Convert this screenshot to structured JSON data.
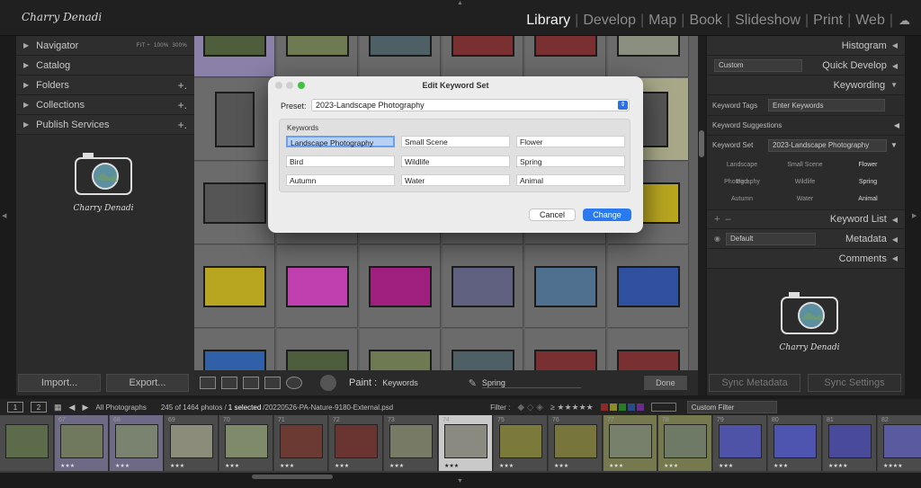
{
  "top": {
    "logo_text": "Charry Denadi",
    "modules": [
      "Library",
      "Develop",
      "Map",
      "Book",
      "Slideshow",
      "Print",
      "Web"
    ],
    "active_module": "Library"
  },
  "left_panel": {
    "navigator": {
      "label": "Navigator",
      "zoom": [
        "FIT ÷",
        "100%",
        "300%"
      ]
    },
    "items": [
      {
        "label": "Catalog",
        "plus": ""
      },
      {
        "label": "Folders",
        "plus": "+."
      },
      {
        "label": "Collections",
        "plus": "+."
      },
      {
        "label": "Publish Services",
        "plus": "+."
      }
    ],
    "import_label": "Import...",
    "export_label": "Export..."
  },
  "toolbar": {
    "paint_label": "Paint :",
    "paint_value": "Keywords",
    "spring_label": "Spring",
    "done_label": "Done"
  },
  "right_panel": {
    "histogram": "Histogram",
    "quick_develop": "Quick Develop",
    "quick_develop_value": "Custom",
    "keywording": "Keywording",
    "keyword_tags_label": "Keyword Tags",
    "keyword_tags_value": "Enter Keywords",
    "keyword_suggestions": "Keyword Suggestions",
    "keyword_set_label": "Keyword Set",
    "keyword_set_value": "2023-Landscape Photography",
    "keyword_grid": [
      "Landscape Photography",
      "Small Scene",
      "Flower",
      "Bird",
      "Wildlife",
      "Spring",
      "Autumn",
      "Water",
      "Animal"
    ],
    "keyword_list": "Keyword List",
    "metadata": "Metadata",
    "metadata_value": "Default",
    "comments": "Comments",
    "sync_metadata": "Sync Metadata",
    "sync_settings": "Sync Settings"
  },
  "filmstrip": {
    "page1": "1",
    "page2": "2",
    "source": "All Photographs",
    "count": "245 of 1464 photos /",
    "selected": "1 selected",
    "filename": "/20220526-PA-Nature-9180-External.psd",
    "filter_label": "Filter :",
    "filter_value": "Custom Filter",
    "cells": [
      {
        "num": "",
        "stars": "",
        "color": "#5c6b4a"
      },
      {
        "num": "67",
        "stars": "★★★",
        "color": "#70785e"
      },
      {
        "num": "68",
        "stars": "★★★",
        "color": "#7a8270"
      },
      {
        "num": "69",
        "stars": "★★★",
        "color": "#8b8d7a"
      },
      {
        "num": "70",
        "stars": "★★★",
        "color": "#7e8a6a"
      },
      {
        "num": "71",
        "stars": "★★★",
        "color": "#6b3a32"
      },
      {
        "num": "72",
        "stars": "★★★",
        "color": "#6a3430"
      },
      {
        "num": "73",
        "stars": "★★★",
        "color": "#777a64"
      },
      {
        "num": "74",
        "stars": "★★★",
        "color": "#8a8a80"
      },
      {
        "num": "75",
        "stars": "★★★",
        "color": "#7c7a3a"
      },
      {
        "num": "76",
        "stars": "★★★",
        "color": "#77743c"
      },
      {
        "num": "77",
        "stars": "★★★",
        "color": "#76806a"
      },
      {
        "num": "78",
        "stars": "★★★",
        "color": "#6e7a66"
      },
      {
        "num": "79",
        "stars": "★★★",
        "color": "#4e53a8"
      },
      {
        "num": "80",
        "stars": "★★★",
        "color": "#4e55b0"
      },
      {
        "num": "81",
        "stars": "★★★★",
        "color": "#4a4a9a"
      },
      {
        "num": "82",
        "stars": "★★★★",
        "color": "#5a5aa0"
      }
    ]
  },
  "dialog": {
    "title": "Edit Keyword Set",
    "preset_label": "Preset:",
    "preset_value": "2023-Landscape Photography",
    "keywords_label": "Keywords",
    "keywords": [
      "Landscape Photography",
      "Small Scene",
      "Flower",
      "Bird",
      "Wildlife",
      "Spring",
      "Autumn",
      "Water",
      "Animal"
    ],
    "cancel": "Cancel",
    "change": "Change"
  },
  "grid_colors": [
    "#4e5e3c",
    "#6d7a52",
    "#4f5f66",
    "#7a3030",
    "#7a3030",
    "#8a8f80",
    "#555",
    "#777",
    "#6a6a66",
    "#7a8470",
    "#3a3a9a",
    "#555",
    "#555",
    "#555",
    "#4a6aa0",
    "#b8a620",
    "#b8a620",
    "#b8a620",
    "#b8a620",
    "#c040b0",
    "#a02080",
    "#606080",
    "#507090",
    "#3050a0",
    "#3060a8"
  ]
}
